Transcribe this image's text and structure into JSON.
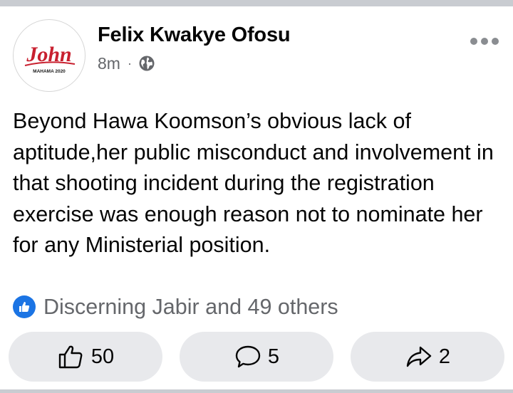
{
  "post": {
    "author": "Felix Kwakye Ofosu",
    "time": "8m",
    "separator": "·",
    "privacy_icon": "globe-icon",
    "more_icon": "more-dots-icon",
    "avatar": {
      "logo_text": "John",
      "logo_subtext": "MAHAMA 2020",
      "logo_color": "#c8202f"
    },
    "text": "Beyond Hawa Koomson’s obvious lack of aptitude,her public misconduct and involvement in that shooting incident during the registration exercise was enough reason not to nominate her for any Ministerial position.",
    "reactions": {
      "icon": "like-icon",
      "summary": "Discerning Jabir and 49 others"
    },
    "actions": {
      "like": {
        "icon": "thumbs-up-icon",
        "count": "50"
      },
      "comment": {
        "icon": "comment-icon",
        "count": "5"
      },
      "share": {
        "icon": "share-icon",
        "count": "2"
      }
    }
  },
  "colors": {
    "accent": "#1b74e4",
    "muted_text": "#65676b",
    "button_bg": "#e8e9ec",
    "divider": "#c9ccd1"
  }
}
